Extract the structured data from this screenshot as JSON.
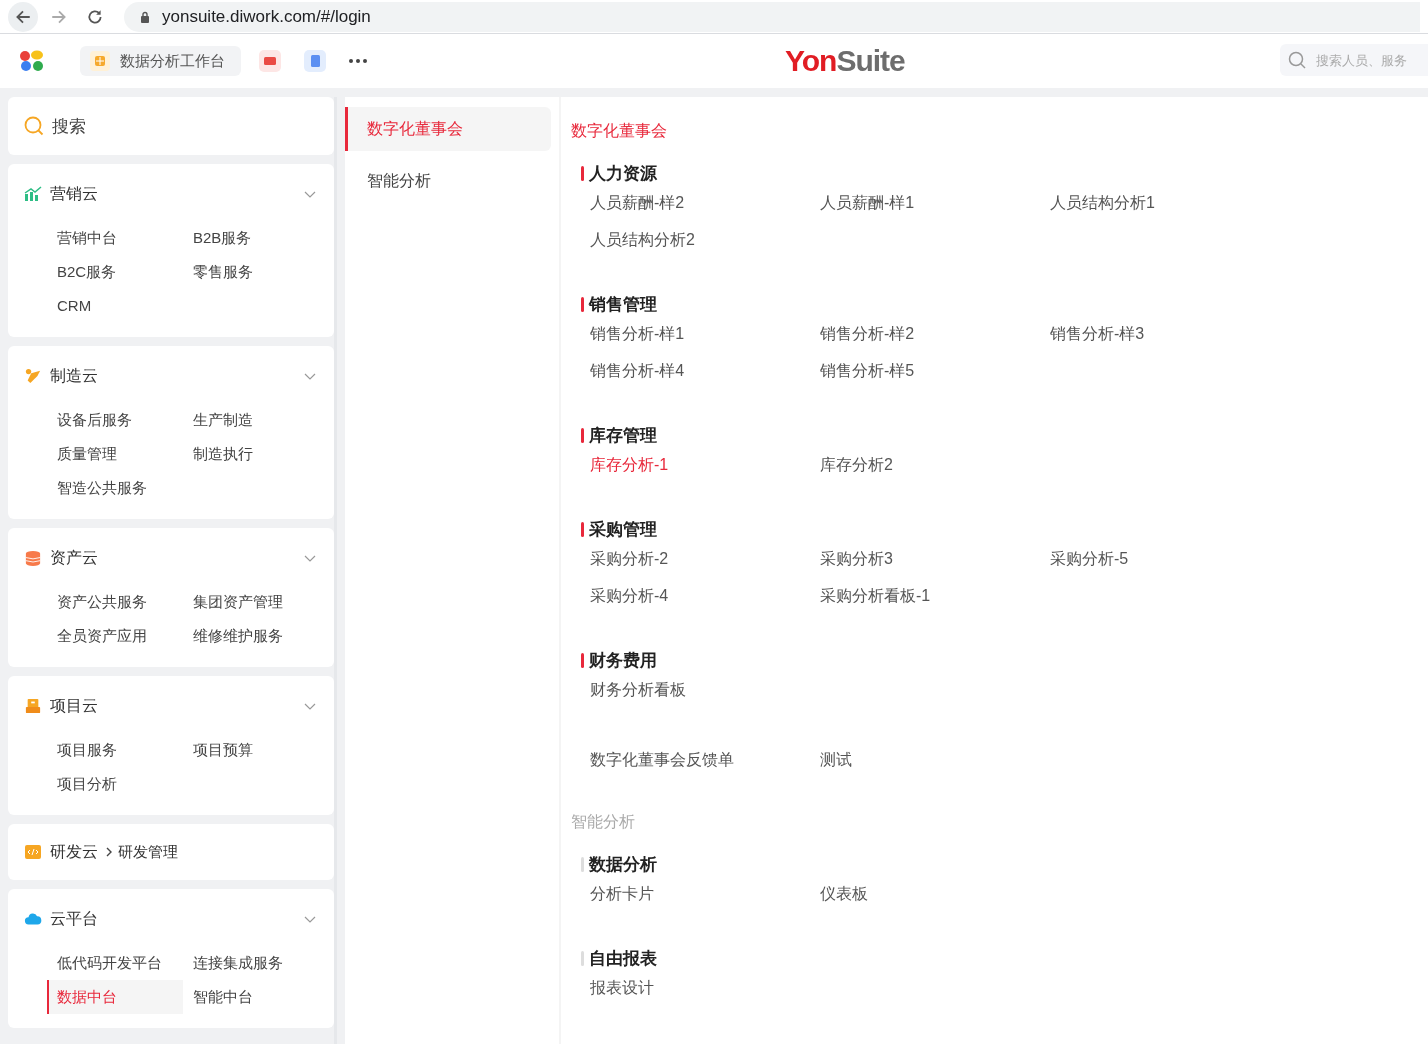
{
  "browser": {
    "url": "yonsuite.diwork.com/#/login"
  },
  "header": {
    "tabs": [
      {
        "kind": "text",
        "label": "数据分析工作台"
      },
      {
        "kind": "icon"
      },
      {
        "kind": "icon"
      }
    ],
    "logo": {
      "lead": "Yon",
      "rest": "Suite"
    },
    "search": {
      "placeholder": "搜索人员、服务"
    }
  },
  "sidebar": {
    "search": {
      "label": "搜索"
    },
    "cards": [
      {
        "kind": "group",
        "title": "营销云",
        "items": [
          {
            "label": "营销中台",
            "selected": false
          },
          {
            "label": "B2B服务",
            "selected": false
          },
          {
            "label": "B2C服务",
            "selected": false
          },
          {
            "label": "零售服务",
            "selected": false
          },
          {
            "label": "CRM",
            "selected": false
          }
        ]
      },
      {
        "kind": "group",
        "title": "制造云",
        "items": [
          {
            "label": "设备后服务",
            "selected": false
          },
          {
            "label": "生产制造",
            "selected": false
          },
          {
            "label": "质量管理",
            "selected": false
          },
          {
            "label": "制造执行",
            "selected": false
          },
          {
            "label": "智造公共服务",
            "selected": false
          }
        ]
      },
      {
        "kind": "group",
        "title": "资产云",
        "items": [
          {
            "label": "资产公共服务",
            "selected": false
          },
          {
            "label": "集团资产管理",
            "selected": false
          },
          {
            "label": "全员资产应用",
            "selected": false
          },
          {
            "label": "维修维护服务",
            "selected": false
          }
        ]
      },
      {
        "kind": "group",
        "title": "项目云",
        "items": [
          {
            "label": "项目服务",
            "selected": false
          },
          {
            "label": "项目预算",
            "selected": false
          },
          {
            "label": "项目分析",
            "selected": false
          }
        ]
      },
      {
        "kind": "link",
        "title": "研发云",
        "target": "研发管理"
      },
      {
        "kind": "group",
        "title": "云平台",
        "items": [
          {
            "label": "低代码开发平台",
            "selected": false
          },
          {
            "label": "连接集成服务",
            "selected": false
          },
          {
            "label": "数据中台",
            "selected": true
          },
          {
            "label": "智能中台",
            "selected": false
          }
        ]
      }
    ]
  },
  "menu": [
    {
      "label": "数字化董事会",
      "selected": true
    },
    {
      "label": "智能分析",
      "selected": false
    }
  ],
  "content": [
    {
      "title": "数字化董事会",
      "active": true,
      "groups": [
        {
          "title": "人力资源",
          "items": [
            {
              "label": "人员薪酬-样2",
              "selected": false
            },
            {
              "label": "人员薪酬-样1",
              "selected": false
            },
            {
              "label": "人员结构分析1",
              "selected": false
            },
            {
              "label": "人员结构分析2",
              "selected": false
            }
          ]
        },
        {
          "title": "销售管理",
          "items": [
            {
              "label": "销售分析-样1",
              "selected": false
            },
            {
              "label": "销售分析-样2",
              "selected": false
            },
            {
              "label": "销售分析-样3",
              "selected": false
            },
            {
              "label": "销售分析-样4",
              "selected": false
            },
            {
              "label": "销售分析-样5",
              "selected": false
            }
          ]
        },
        {
          "title": "库存管理",
          "items": [
            {
              "label": "库存分析-1",
              "selected": true
            },
            {
              "label": "库存分析2",
              "selected": false
            }
          ]
        },
        {
          "title": "采购管理",
          "items": [
            {
              "label": "采购分析-2",
              "selected": false
            },
            {
              "label": "采购分析3",
              "selected": false
            },
            {
              "label": "采购分析-5",
              "selected": false
            },
            {
              "label": "采购分析-4",
              "selected": false
            },
            {
              "label": "采购分析看板-1",
              "selected": false
            }
          ]
        },
        {
          "title": "财务费用",
          "items": [
            {
              "label": "财务分析看板",
              "selected": false
            }
          ]
        },
        {
          "items": [
            {
              "label": "数字化董事会反馈单",
              "selected": false
            },
            {
              "label": "测试",
              "selected": false
            }
          ]
        }
      ]
    },
    {
      "title": "智能分析",
      "active": false,
      "groups": [
        {
          "title": "数据分析",
          "items": [
            {
              "label": "分析卡片",
              "selected": false
            },
            {
              "label": "仪表板",
              "selected": false
            }
          ]
        },
        {
          "title": "自由报表",
          "items": [
            {
              "label": "报表设计",
              "selected": false
            }
          ]
        }
      ]
    }
  ]
}
